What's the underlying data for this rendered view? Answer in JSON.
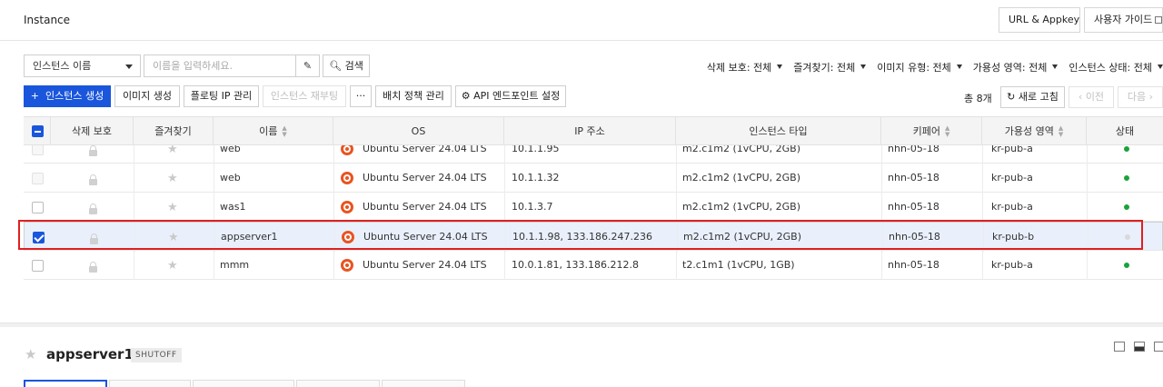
{
  "header": {
    "title": "Instance",
    "url_appkey": "URL & Appkey",
    "user_guide": "사용자 가이드"
  },
  "search": {
    "field_select": "인스턴스 이름",
    "placeholder": "이름을 입력하세요.",
    "search_label": "검색"
  },
  "filters": [
    "삭제 보호: 전체",
    "즐겨찾기: 전체",
    "이미지 유형: 전체",
    "가용성 영역: 전체",
    "인스턴스 상태: 전체"
  ],
  "actions": {
    "create": "인스턴스 생성",
    "create_image": "이미지 생성",
    "floating_ip": "플로팅 IP 관리",
    "reboot": "인스턴스 재부팅",
    "more": "···",
    "batch_policy": "배치 정책 관리",
    "api_endpoint": "API 엔드포인트 설정"
  },
  "pagination": {
    "total": "총 8개",
    "refresh": "새로 고침",
    "prev": "‹ 이전",
    "next": "다음 ›"
  },
  "table": {
    "columns": [
      "삭제 보호",
      "즐겨찾기",
      "이름",
      "OS",
      "IP 주소",
      "인스턴스 타입",
      "키페어",
      "가용성 영역",
      "상태"
    ],
    "rows": [
      {
        "name": "web",
        "os": "Ubuntu Server 24.04 LTS",
        "ip": "10.1.1.95",
        "type": "m2.c1m2 (1vCPU, 2GB)",
        "keypair": "nhn-05-18",
        "zone": "kr-pub-a",
        "running": true,
        "selected": false
      },
      {
        "name": "web",
        "os": "Ubuntu Server 24.04 LTS",
        "ip": "10.1.1.32",
        "type": "m2.c1m2 (1vCPU, 2GB)",
        "keypair": "nhn-05-18",
        "zone": "kr-pub-a",
        "running": true,
        "selected": false
      },
      {
        "name": "was1",
        "os": "Ubuntu Server 24.04 LTS",
        "ip": "10.1.3.7",
        "type": "m2.c1m2 (1vCPU, 2GB)",
        "keypair": "nhn-05-18",
        "zone": "kr-pub-a",
        "running": true,
        "selected": false
      },
      {
        "name": "appserver1",
        "os": "Ubuntu Server 24.04 LTS",
        "ip": "10.1.1.98, 133.186.247.236",
        "type": "m2.c1m2 (1vCPU, 2GB)",
        "keypair": "nhn-05-18",
        "zone": "kr-pub-b",
        "running": false,
        "selected": true
      },
      {
        "name": "mmm",
        "os": "Ubuntu Server 24.04 LTS",
        "ip": "10.0.1.81, 133.186.212.8",
        "type": "t2.c1m1 (1vCPU, 1GB)",
        "keypair": "nhn-05-18",
        "zone": "kr-pub-a",
        "running": true,
        "selected": false
      }
    ]
  },
  "detail": {
    "name": "appserver1",
    "status": "SHUTOFF"
  },
  "colors": {
    "primary": "#1a56db",
    "running": "#19a33a",
    "stopped": "#d9d9d9",
    "highlight": "#e02020",
    "ubuntu": "#e95420"
  }
}
